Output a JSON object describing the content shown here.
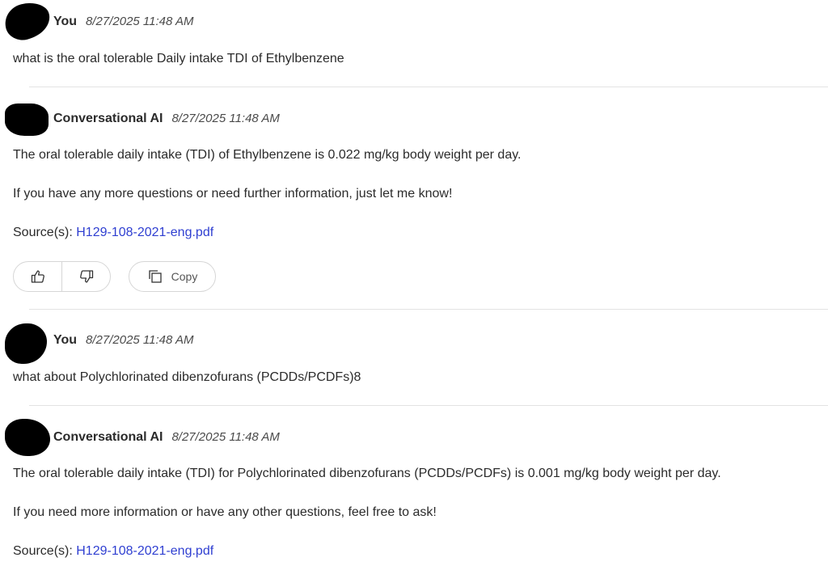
{
  "messages": [
    {
      "author": "You",
      "timestamp": "8/27/2025 11:48 AM",
      "text": "what is the oral tolerable Daily intake TDI of Ethylbenzene"
    },
    {
      "author": "Conversational AI",
      "timestamp": "8/27/2025 11:48 AM",
      "line1": "The oral tolerable daily intake (TDI) of Ethylbenzene is 0.022 mg/kg body weight per day.",
      "line2": "If you have any more questions or need further information, just let me know!",
      "source_label": "Source(s):",
      "source_link": "H129-108-2021-eng.pdf"
    },
    {
      "author": "You",
      "timestamp": "8/27/2025 11:48 AM",
      "text": "what about Polychlorinated dibenzofurans (PCDDs/PCDFs)8"
    },
    {
      "author": "Conversational AI",
      "timestamp": "8/27/2025 11:48 AM",
      "line1": "The oral tolerable daily intake (TDI) for Polychlorinated dibenzofurans (PCDDs/PCDFs) is 0.001 mg/kg body weight per day.",
      "line2": "If you need more information or have any other questions, feel free to ask!",
      "source_label": "Source(s):",
      "source_link": "H129-108-2021-eng.pdf"
    }
  ],
  "actions": {
    "copy_label": "Copy",
    "thumbs_up_icon": "thumbs-up-icon",
    "thumbs_down_icon": "thumbs-down-icon",
    "copy_icon": "copy-icon"
  },
  "colors": {
    "link": "#2f3fd1",
    "divider": "#e3e3e3",
    "text": "#2b2b2b"
  }
}
